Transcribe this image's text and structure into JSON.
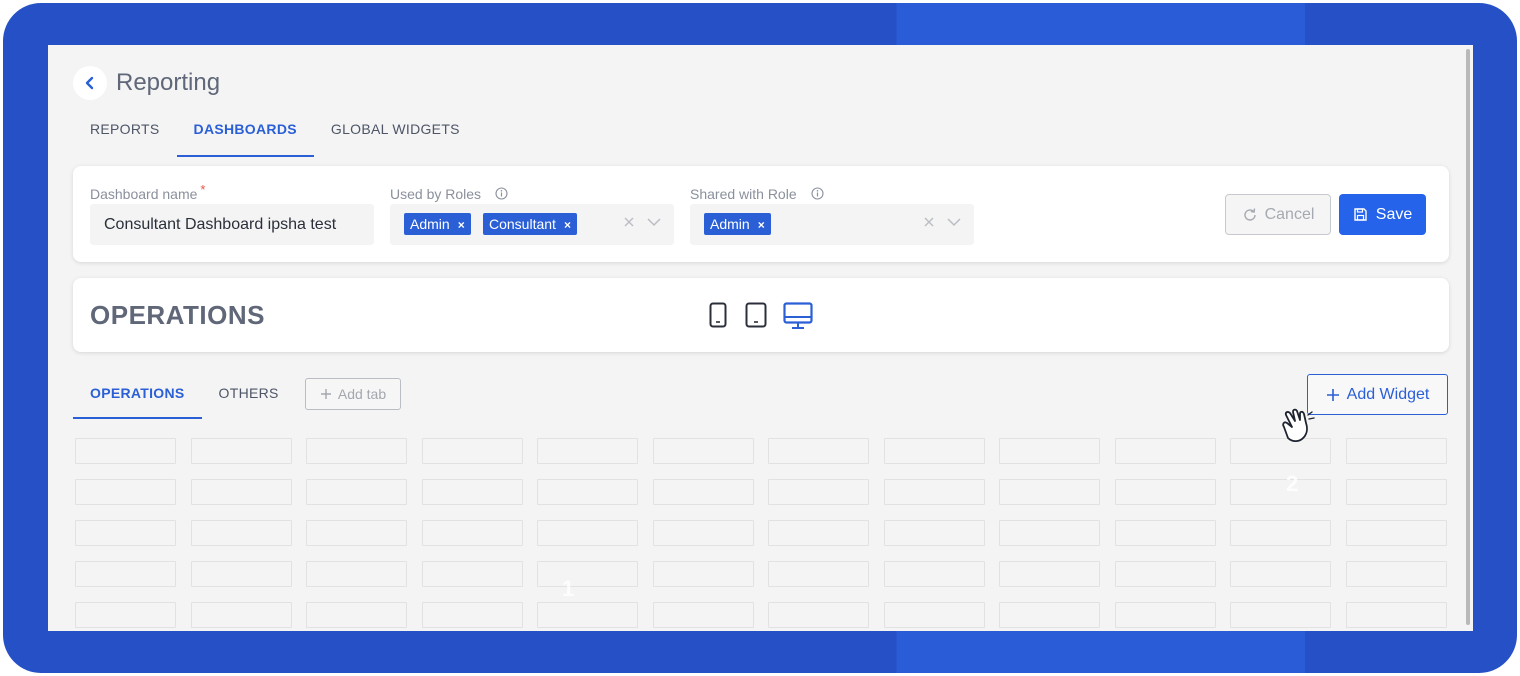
{
  "header": {
    "title": "Reporting",
    "back_icon": "chevron-left-icon"
  },
  "main_tabs": [
    {
      "label": "REPORTS",
      "active": false
    },
    {
      "label": "DASHBOARDS",
      "active": true
    },
    {
      "label": "GLOBAL WIDGETS",
      "active": false
    }
  ],
  "settings": {
    "dashboard_name": {
      "label": "Dashboard name",
      "required_mark": "*",
      "value": "Consultant Dashboard ipsha test"
    },
    "used_by_roles": {
      "label": "Used by Roles",
      "chips": [
        "Admin",
        "Consultant"
      ],
      "chip_remove": "×"
    },
    "shared_with_role": {
      "label": "Shared with Role",
      "chips": [
        "Admin"
      ],
      "chip_remove": "×"
    },
    "cancel_label": "Cancel",
    "save_label": "Save"
  },
  "section": {
    "title": "OPERATIONS",
    "devices": [
      "mobile-icon",
      "tablet-icon",
      "desktop-icon"
    ],
    "selected_device": "desktop-icon"
  },
  "sub_tabs": [
    {
      "label": "OPERATIONS",
      "active": true
    },
    {
      "label": "OTHERS",
      "active": false
    }
  ],
  "add_tab_label": "Add tab",
  "add_widget_label": "Add Widget",
  "grid": {
    "columns": 12,
    "rows": 5
  },
  "markers": [
    "1",
    "2"
  ],
  "colors": {
    "frame": "#2550c6",
    "accent": "#2563eb",
    "background": "#f4f4f4",
    "text": "#5f6778"
  }
}
